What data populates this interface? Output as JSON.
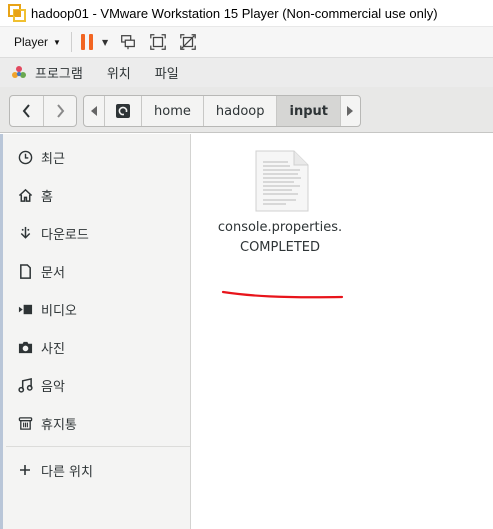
{
  "window": {
    "title": "hadoop01 - VMware Workstation 15 Player (Non-commercial use only)"
  },
  "vm_toolbar": {
    "player_label": "Player"
  },
  "gnome_bar": {
    "menus": [
      "프로그램",
      "위치",
      "파일"
    ]
  },
  "pathbar": {
    "items": [
      "home",
      "hadoop",
      "input"
    ],
    "active": "input"
  },
  "sidebar": {
    "items": [
      {
        "label": "최근",
        "icon": "clock-icon"
      },
      {
        "label": "홈",
        "icon": "home-icon"
      },
      {
        "label": "다운로드",
        "icon": "download-icon"
      },
      {
        "label": "문서",
        "icon": "document-icon"
      },
      {
        "label": "비디오",
        "icon": "video-icon"
      },
      {
        "label": "사진",
        "icon": "camera-icon"
      },
      {
        "label": "음악",
        "icon": "music-icon"
      },
      {
        "label": "휴지통",
        "icon": "trash-icon"
      },
      {
        "label": "다른 위치",
        "icon": "plus-icon"
      }
    ]
  },
  "files": [
    {
      "name_line1": "console.properties.",
      "name_line2": "COMPLETED",
      "icon": "text-file-icon"
    }
  ],
  "colors": {
    "pause": "#f26522",
    "annotation_underline": "#e8141b"
  }
}
